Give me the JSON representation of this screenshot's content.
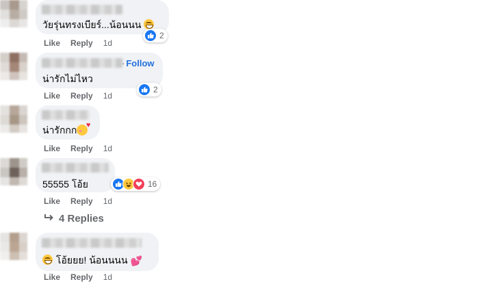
{
  "comments": [
    {
      "follow_label": "",
      "text": "วัยรุ่นทรงเบียร์...น้อนนน",
      "emoji_icon": "grinning-face-emoji",
      "reaction_icons": [
        "like-reaction-icon"
      ],
      "reaction_count": "2",
      "like_label": "Like",
      "reply_label": "Reply",
      "time": "1d"
    },
    {
      "follow_label": "Follow",
      "text": "น่ารักไม่ไหว",
      "emoji_icon": "",
      "reaction_icons": [
        "like-reaction-icon"
      ],
      "reaction_count": "2",
      "like_label": "Like",
      "reply_label": "Reply",
      "time": "1d"
    },
    {
      "follow_label": "",
      "text": "น่ารักกก",
      "emoji_icon": "smiling-face-with-hearts-emoji",
      "reaction_icons": [],
      "reaction_count": "",
      "like_label": "Like",
      "reply_label": "Reply",
      "time": "1d"
    },
    {
      "follow_label": "",
      "text": "55555 โอ้ย",
      "emoji_icon": "",
      "reaction_icons": [
        "like-reaction-icon",
        "haha-reaction-icon",
        "love-reaction-icon"
      ],
      "reaction_count": "16",
      "like_label": "Like",
      "reply_label": "Reply",
      "time": "1d",
      "replies_label": "4 Replies"
    },
    {
      "follow_label": "",
      "text_prefix_emoji": "grinning-face-emoji",
      "text": "โอ้ยยย! น้อนนนน",
      "emoji_icon": "two-hearts-emoji",
      "reaction_icons": [],
      "reaction_count": "",
      "like_label": "Like",
      "reply_label": "Reply",
      "time": "1d"
    }
  ],
  "colors": {
    "bubble": "#f0f2f5",
    "link_blue": "#216fdb",
    "meta_gray": "#65676b",
    "like_blue": "#1877f2",
    "love_red": "#f33e58",
    "haha_yellow": "#ffc83d"
  }
}
